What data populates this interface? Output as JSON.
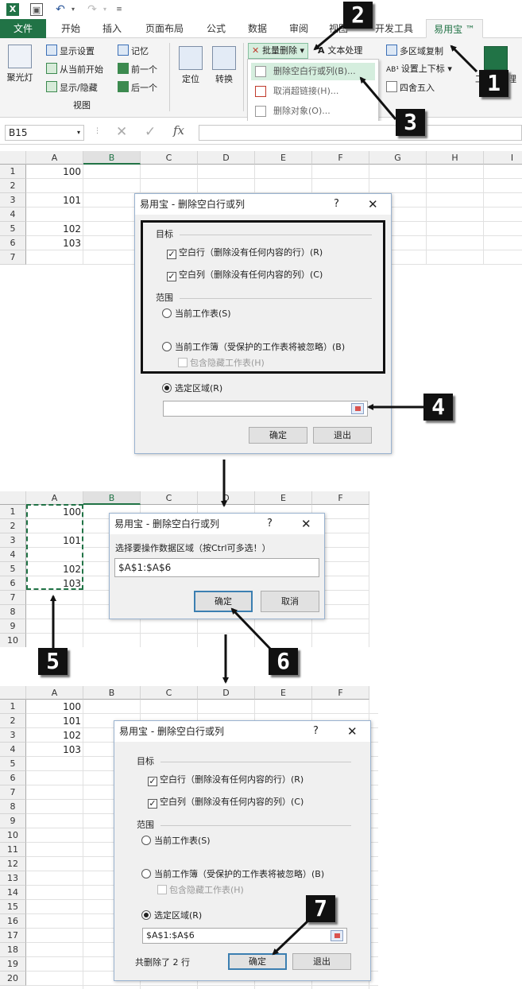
{
  "quick_access": {
    "excel_icon": "excel-icon",
    "save_icon": "save-icon",
    "undo_icon": "undo-icon",
    "redo_icon": "redo-icon",
    "more_icon": "customize-icon"
  },
  "tabs": [
    "文件",
    "开始",
    "插入",
    "页面布局",
    "公式",
    "数据",
    "审阅",
    "视图",
    "开发工具",
    "易用宝 ™"
  ],
  "ribbon": {
    "spotlight": "聚光灯",
    "view_items": [
      "显示设置",
      "从当前开始",
      "显示/隐藏"
    ],
    "memory_items": [
      "记忆",
      "前一个",
      "后一个"
    ],
    "view_group": "视图",
    "locate": "定位",
    "convert": "转换",
    "batch_delete": "批量删除",
    "text_process": "文本处理",
    "multi_copy": "多区域复制",
    "sub_sup": "设置上下标",
    "round": "四舍五入",
    "toolbox_partial": "工",
    "toolbox_end": "理"
  },
  "menu": [
    "删除空白行或列(B)...",
    "取消超链接(H)...",
    "删除对象(O)..."
  ],
  "formula_bar": {
    "name_box": "B15",
    "fx": "fx",
    "cancel": "✕",
    "enter": "✓"
  },
  "sheet1": {
    "cols": [
      "A",
      "B",
      "C",
      "D",
      "E",
      "F",
      "G",
      "H",
      "I"
    ],
    "rows": [
      "1",
      "2",
      "3",
      "4",
      "5",
      "6",
      "7"
    ],
    "values": {
      "1": "100",
      "3": "101",
      "5": "102",
      "6": "103"
    }
  },
  "sheet2": {
    "cols": [
      "A",
      "B",
      "C",
      "D",
      "E",
      "F"
    ],
    "rows": [
      "1",
      "2",
      "3",
      "4",
      "5",
      "6",
      "7",
      "8",
      "9",
      "10"
    ],
    "values": {
      "1": "100",
      "3": "101",
      "5": "102",
      "6": "103"
    }
  },
  "sheet3": {
    "cols": [
      "A",
      "B",
      "C",
      "D",
      "E",
      "F"
    ],
    "rows": [
      "1",
      "2",
      "3",
      "4",
      "5",
      "6",
      "7",
      "8",
      "9",
      "10",
      "11",
      "12",
      "13",
      "14",
      "15",
      "16",
      "17",
      "18",
      "19",
      "20"
    ],
    "values": {
      "1": "100",
      "2": "101",
      "3": "102",
      "4": "103"
    }
  },
  "dialog1": {
    "title": "易用宝 - 删除空白行或列",
    "help": "?",
    "close": "✕",
    "target": "目标",
    "blank_rows": "空白行（删除没有任何内容的行）(R)",
    "blank_cols": "空白列（删除没有任何内容的列）(C)",
    "scope": "范围",
    "current_sheet": "当前工作表(S)",
    "current_book": "当前工作簿（受保护的工作表将被忽略）(B)",
    "include_hidden": "包含隐藏工作表(H)",
    "selection": "选定区域(R)",
    "range_value": "",
    "ok": "确定",
    "exit": "退出"
  },
  "dialog2": {
    "title": "易用宝 - 删除空白行或列",
    "help": "?",
    "close": "✕",
    "prompt": "选择要操作数据区域（按Ctrl可多选！）",
    "range_value": "$A$1:$A$6",
    "ok": "确定",
    "cancel": "取消"
  },
  "dialog3": {
    "title": "易用宝 - 删除空白行或列",
    "help": "?",
    "close": "✕",
    "target": "目标",
    "blank_rows": "空白行（删除没有任何内容的行）(R)",
    "blank_cols": "空白列（删除没有任何内容的列）(C)",
    "scope": "范围",
    "current_sheet": "当前工作表(S)",
    "current_book": "当前工作簿（受保护的工作表将被忽略）(B)",
    "include_hidden": "包含隐藏工作表(H)",
    "selection": "选定区域(R)",
    "range_value": "$A$1:$A$6",
    "status": "共删除了 2 行",
    "ok": "确定",
    "exit": "退出"
  },
  "steps": [
    "1",
    "2",
    "3",
    "4",
    "5",
    "6",
    "7"
  ]
}
